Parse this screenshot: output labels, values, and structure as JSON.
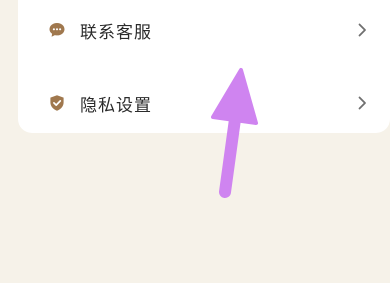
{
  "menu": {
    "items": [
      {
        "label": "联系客服",
        "icon": "chat-bubble-icon",
        "trailing_icon": "chevron-right-icon"
      },
      {
        "label": "隐私设置",
        "icon": "shield-check-icon",
        "trailing_icon": "chevron-right-icon"
      }
    ]
  },
  "colors": {
    "page_background": "#f6f2e9",
    "card_background": "#ffffff",
    "icon_brown": "#a0784e",
    "chevron_gray": "#6f6f6f",
    "gesture_arrow": "#cf84f0"
  }
}
